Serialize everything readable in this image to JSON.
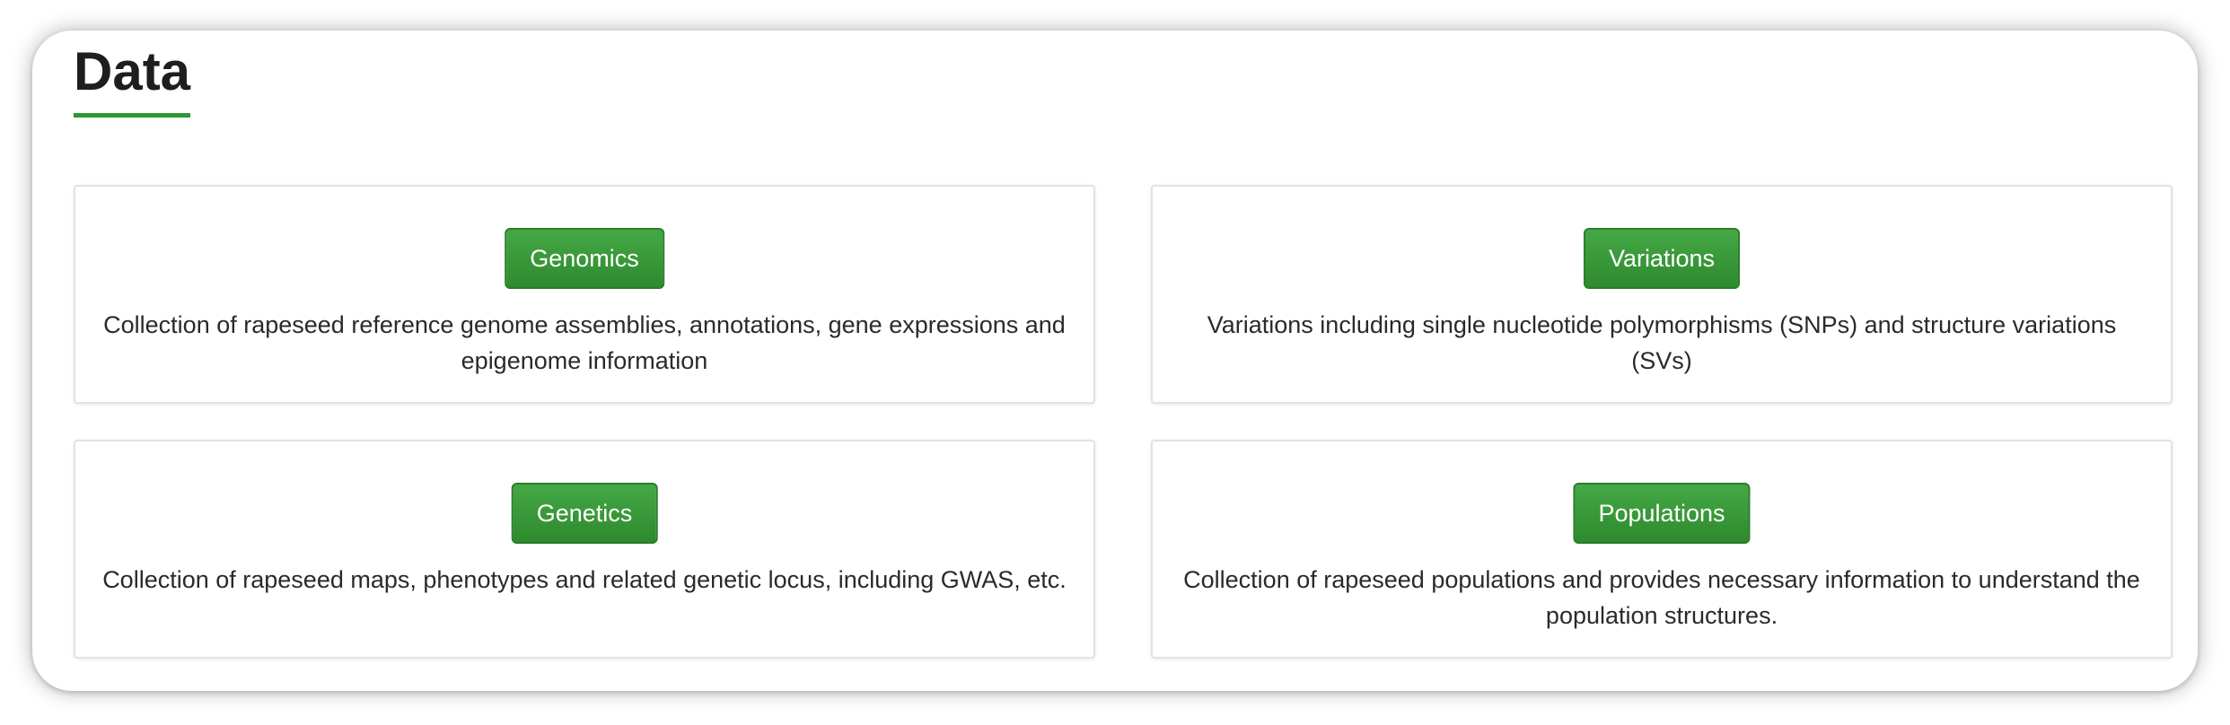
{
  "page": {
    "title": "Data"
  },
  "cards": [
    {
      "button_label": "Genomics",
      "description": "Collection of rapeseed reference genome assemblies, annotations, gene expressions and epigenome information"
    },
    {
      "button_label": "Variations",
      "description": "Variations including single nucleotide polymorphisms (SNPs) and structure variations (SVs)"
    },
    {
      "button_label": "Genetics",
      "description": "Collection of rapeseed maps, phenotypes and related genetic locus, including GWAS, etc."
    },
    {
      "button_label": "Populations",
      "description": "Collection of rapeseed populations and provides necessary information to understand the population structures."
    }
  ],
  "colors": {
    "accent": "#2e9634",
    "button_top": "#45a845",
    "button_bottom": "#2e8a2e",
    "text": "#2a2a2a"
  }
}
